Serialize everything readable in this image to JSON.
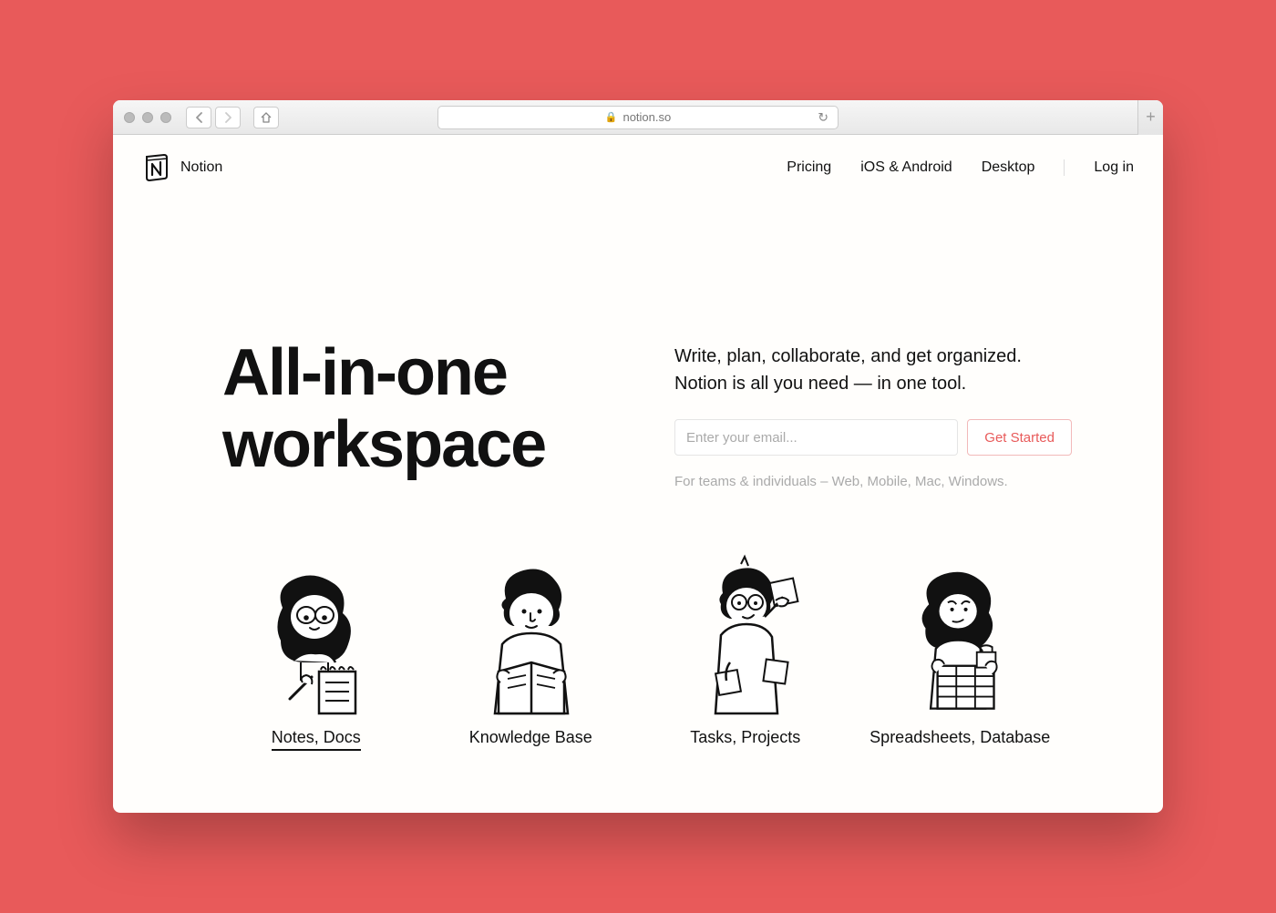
{
  "browser": {
    "url_display": "notion.so"
  },
  "header": {
    "logo_text": "Notion",
    "nav": {
      "pricing": "Pricing",
      "mobile": "iOS & Android",
      "desktop": "Desktop",
      "login": "Log in"
    }
  },
  "hero": {
    "title_line1": "All-in-one",
    "title_line2": "workspace",
    "subtitle": "Write, plan, collaborate, and get organized. Notion is all you need — in one tool.",
    "email_placeholder": "Enter your email...",
    "cta": "Get Started",
    "meta": "For teams & individuals – Web, Mobile, Mac, Windows."
  },
  "features": [
    {
      "label": "Notes, Docs",
      "active": true
    },
    {
      "label": "Knowledge Base",
      "active": false
    },
    {
      "label": "Tasks, Projects",
      "active": false
    },
    {
      "label": "Spreadsheets, Database",
      "active": false
    }
  ]
}
